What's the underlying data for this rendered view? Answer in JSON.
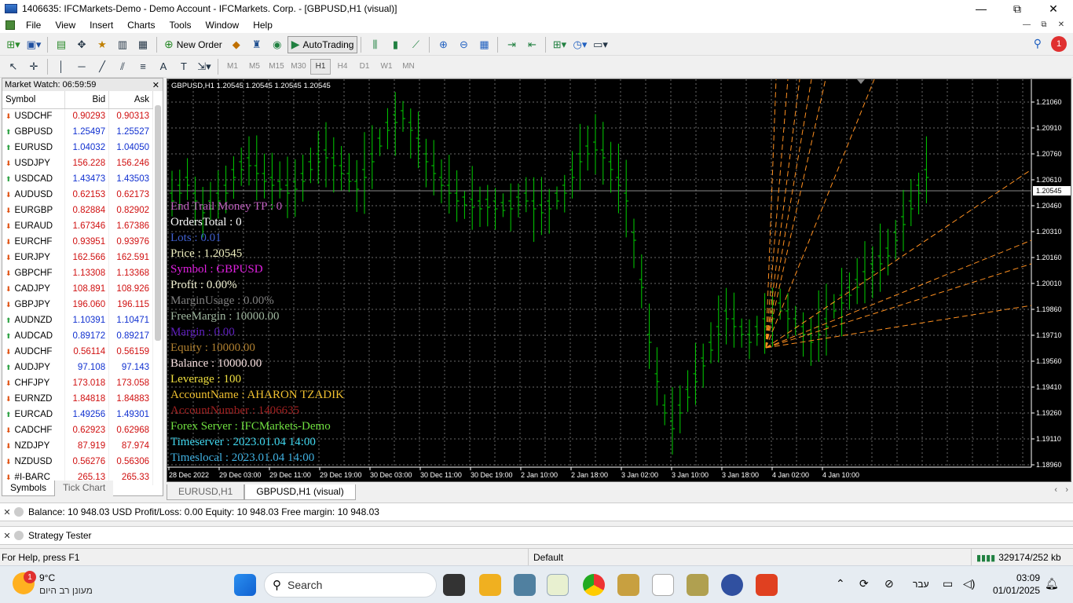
{
  "window": {
    "title": "1406635: IFCMarkets-Demo - Demo Account - IFCMarkets. Corp. - [GBPUSD,H1 (visual)]",
    "minimize": "—",
    "restore": "⧉",
    "close": "✕"
  },
  "menu": [
    "File",
    "View",
    "Insert",
    "Charts",
    "Tools",
    "Window",
    "Help"
  ],
  "toolbar1": {
    "new_order": "New Order",
    "autotrading": "AutoTrading",
    "notification_count": "1"
  },
  "timeframes": [
    "M1",
    "M5",
    "M15",
    "M30",
    "H1",
    "H4",
    "D1",
    "W1",
    "MN"
  ],
  "active_timeframe": "H1",
  "market_watch": {
    "title": "Market Watch: 06:59:59",
    "columns": [
      "Symbol",
      "Bid",
      "Ask"
    ],
    "rows": [
      {
        "symbol": "USDCHF",
        "bid": "0.90293",
        "ask": "0.90313",
        "dir": "down"
      },
      {
        "symbol": "GBPUSD",
        "bid": "1.25497",
        "ask": "1.25527",
        "dir": "up"
      },
      {
        "symbol": "EURUSD",
        "bid": "1.04032",
        "ask": "1.04050",
        "dir": "up"
      },
      {
        "symbol": "USDJPY",
        "bid": "156.228",
        "ask": "156.246",
        "dir": "down"
      },
      {
        "symbol": "USDCAD",
        "bid": "1.43473",
        "ask": "1.43503",
        "dir": "up"
      },
      {
        "symbol": "AUDUSD",
        "bid": "0.62153",
        "ask": "0.62173",
        "dir": "down"
      },
      {
        "symbol": "EURGBP",
        "bid": "0.82884",
        "ask": "0.82902",
        "dir": "down"
      },
      {
        "symbol": "EURAUD",
        "bid": "1.67346",
        "ask": "1.67386",
        "dir": "down"
      },
      {
        "symbol": "EURCHF",
        "bid": "0.93951",
        "ask": "0.93976",
        "dir": "down"
      },
      {
        "symbol": "EURJPY",
        "bid": "162.566",
        "ask": "162.591",
        "dir": "down"
      },
      {
        "symbol": "GBPCHF",
        "bid": "1.13308",
        "ask": "1.13368",
        "dir": "down"
      },
      {
        "symbol": "CADJPY",
        "bid": "108.891",
        "ask": "108.926",
        "dir": "down"
      },
      {
        "symbol": "GBPJPY",
        "bid": "196.060",
        "ask": "196.115",
        "dir": "down"
      },
      {
        "symbol": "AUDNZD",
        "bid": "1.10391",
        "ask": "1.10471",
        "dir": "up"
      },
      {
        "symbol": "AUDCAD",
        "bid": "0.89172",
        "ask": "0.89217",
        "dir": "up"
      },
      {
        "symbol": "AUDCHF",
        "bid": "0.56114",
        "ask": "0.56159",
        "dir": "down"
      },
      {
        "symbol": "AUDJPY",
        "bid": "97.108",
        "ask": "97.143",
        "dir": "up"
      },
      {
        "symbol": "CHFJPY",
        "bid": "173.018",
        "ask": "173.058",
        "dir": "down"
      },
      {
        "symbol": "EURNZD",
        "bid": "1.84818",
        "ask": "1.84883",
        "dir": "down"
      },
      {
        "symbol": "EURCAD",
        "bid": "1.49256",
        "ask": "1.49301",
        "dir": "up"
      },
      {
        "symbol": "CADCHF",
        "bid": "0.62923",
        "ask": "0.62968",
        "dir": "down"
      },
      {
        "symbol": "NZDJPY",
        "bid": "87.919",
        "ask": "87.974",
        "dir": "down"
      },
      {
        "symbol": "NZDUSD",
        "bid": "0.56276",
        "ask": "0.56306",
        "dir": "down"
      },
      {
        "symbol": "#I-BARC",
        "bid": "265.13",
        "ask": "265.33",
        "dir": "down"
      }
    ],
    "tabs": [
      "Symbols",
      "Tick Chart"
    ]
  },
  "chart": {
    "header": "GBPUSD,H1  1.20545 1.20545 1.20545 1.20545",
    "current_price": "1.20545",
    "price_labels": [
      "1.21060",
      "1.20910",
      "1.20760",
      "1.20610",
      "1.20460",
      "1.20310",
      "1.20160",
      "1.20010",
      "1.19860",
      "1.19710",
      "1.19560",
      "1.19410",
      "1.19260",
      "1.19110",
      "1.18960"
    ],
    "time_labels": [
      "28 Dec 2022",
      "29 Dec 03:00",
      "29 Dec 11:00",
      "29 Dec 19:00",
      "30 Dec 03:00",
      "30 Dec 11:00",
      "30 Dec 19:00",
      "2 Jan 10:00",
      "2 Jan 18:00",
      "3 Jan 02:00",
      "3 Jan 10:00",
      "3 Jan 18:00",
      "4 Jan 02:00",
      "4 Jan 10:00"
    ],
    "info_lines": [
      {
        "text": "End Trail Money TP    :  0",
        "color": "#c060c0"
      },
      {
        "text": "OrdersTotal    :  0",
        "color": "#ffffff"
      },
      {
        "text": "Lots    :  0.01",
        "color": "#4060d0"
      },
      {
        "text": "Price   :  1.20545",
        "color": "#f0f0c0"
      },
      {
        "text": "Symbol   :  GBPUSD",
        "color": "#e020e0"
      },
      {
        "text": "Profit   :  0.00%",
        "color": "#f0f0d0"
      },
      {
        "text": "MarginUsage   :  0.00%",
        "color": "#808080"
      },
      {
        "text": "FreeMargin   :  10000.00",
        "color": "#a0b8a0"
      },
      {
        "text": "Margin   :  0.00",
        "color": "#6020c0"
      },
      {
        "text": "Equity   :  10000.00",
        "color": "#b08030"
      },
      {
        "text": "Balance   :  10000.00",
        "color": "#f8e0e0"
      },
      {
        "text": "Leverage   :  100",
        "color": "#f0e040"
      },
      {
        "text": "AccountName   :  AHARON TZADIK",
        "color": "#f0c030"
      },
      {
        "text": "AccountNumber   :  1406635",
        "color": "#a02020"
      },
      {
        "text": "Forex Server  :  IFCMarkets-Demo",
        "color": "#70e040"
      },
      {
        "text": "Timeserver  :  2023.01.04 14:00",
        "color": "#40d8f0"
      },
      {
        "text": "Timeslocal  :  2023.01.04 14:00",
        "color": "#40b0e0"
      }
    ]
  },
  "chart_tabs": [
    "EURUSD,H1",
    "GBPUSD,H1 (visual)"
  ],
  "terminal_line": "Balance: 10 948.03 USD  Profit/Loss: 0.00  Equity: 10 948.03  Free margin: 10 948.03",
  "tester_line": "Strategy Tester",
  "statusbar": {
    "help": "For Help, press F1",
    "profile": "Default",
    "traffic": "329174/252 kb"
  },
  "taskbar": {
    "weather_temp": "9°C",
    "weather_text": "מעונן רב היום",
    "weather_badge": "1",
    "search": "Search",
    "lang": "עבר",
    "time": "03:09",
    "date": "01/01/2025"
  }
}
